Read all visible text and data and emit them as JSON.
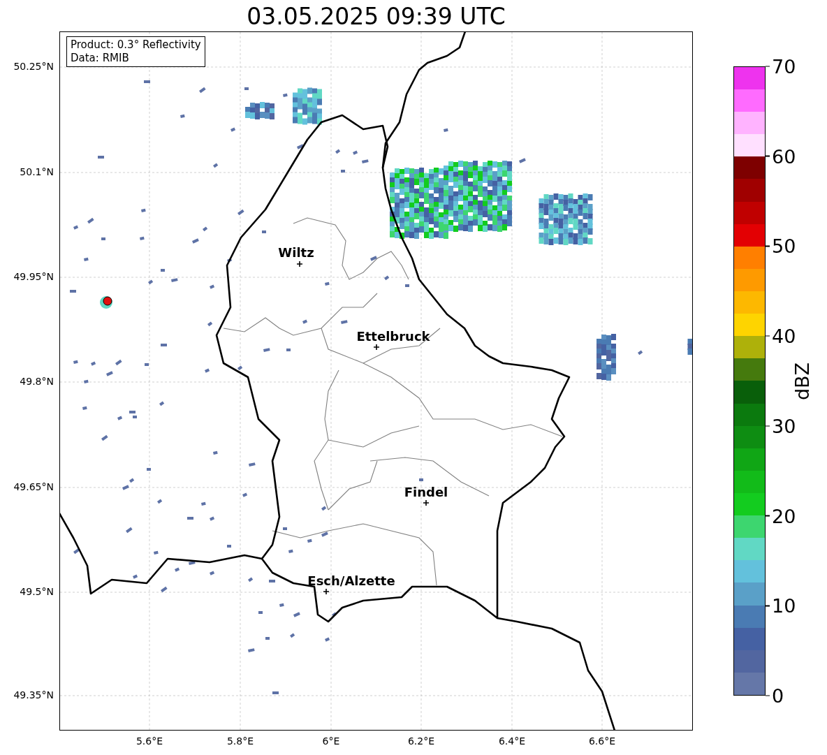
{
  "title": "03.05.2025 09:39 UTC",
  "info_box": {
    "lines": [
      "Product: 0.3° Reflectivity",
      "Data: RMIB"
    ]
  },
  "y_ticks": [
    "50.25°N",
    "50.1°N",
    "49.95°N",
    "49.8°N",
    "49.65°N",
    "49.5°N",
    "49.35°N"
  ],
  "x_ticks": [
    "5.6°E",
    "5.8°E",
    "6°E",
    "6.2°E",
    "6.4°E",
    "6.6°E"
  ],
  "cities": [
    {
      "name": "Wiltz"
    },
    {
      "name": "Ettelbruck"
    },
    {
      "name": "Findel"
    },
    {
      "name": "Esch/Alzette"
    }
  ],
  "colorbar": {
    "label": "dBZ",
    "ticks": [
      "70",
      "60",
      "50",
      "40",
      "30",
      "20",
      "10",
      "0"
    ],
    "segments": [
      {
        "color": "#6577a8"
      },
      {
        "color": "#5266a0"
      },
      {
        "color": "#4561a3"
      },
      {
        "color": "#4a7bb3"
      },
      {
        "color": "#5aa0c8"
      },
      {
        "color": "#63c1dc"
      },
      {
        "color": "#61d8c4"
      },
      {
        "color": "#3dd66f"
      },
      {
        "color": "#13cc1f"
      },
      {
        "color": "#12bb19"
      },
      {
        "color": "#10a615"
      },
      {
        "color": "#0e8d12"
      },
      {
        "color": "#0b7a0e"
      },
      {
        "color": "#095f0a"
      },
      {
        "color": "#457a0d"
      },
      {
        "color": "#aeb10a"
      },
      {
        "color": "#fed400"
      },
      {
        "color": "#fdb800"
      },
      {
        "color": "#fe9a00"
      },
      {
        "color": "#ff7f00"
      },
      {
        "color": "#e30003"
      },
      {
        "color": "#c00000"
      },
      {
        "color": "#a00000"
      },
      {
        "color": "#7e0000"
      },
      {
        "color": "#ffe0ff"
      },
      {
        "color": "#ffb3ff"
      },
      {
        "color": "#ff6bff"
      },
      {
        "color": "#ee33ee"
      }
    ]
  }
}
